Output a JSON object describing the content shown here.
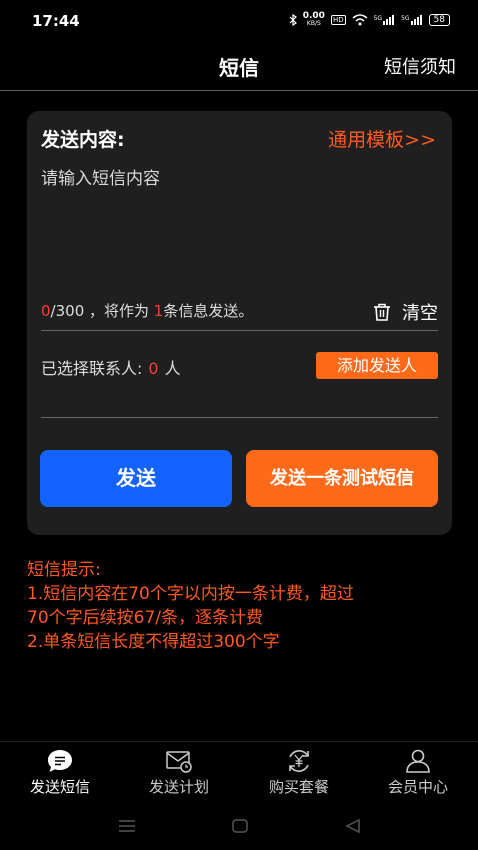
{
  "status_bar": {
    "time": "17:44",
    "speed": "0.00",
    "speed_unit": "KB/S",
    "hd": "HD",
    "signal1": "5G",
    "signal2": "5G",
    "battery": "58"
  },
  "header": {
    "title": "短信",
    "notice_link": "短信须知"
  },
  "compose": {
    "label": "发送内容:",
    "template_link": "通用模板>>",
    "placeholder": "请输入短信内容",
    "char_count": "0",
    "char_limit_text": "/300 ，将作为",
    "message_count": "1",
    "message_count_suffix": "条信息发送。",
    "clear_label": "清空"
  },
  "contacts": {
    "label": "已选择联系人:",
    "count": "0",
    "unit": "人",
    "add_button": "添加发送人"
  },
  "actions": {
    "send_button": "发送",
    "test_button": "发送一条测试短信"
  },
  "tips": {
    "title": "短信提示:",
    "line1": "1.短信内容在70个字以内按一条计费，超过",
    "line2": "70个字后续按67/条，逐条计费",
    "line3": "2.单条短信长度不得超过300个字"
  },
  "tabs": [
    {
      "label": "发送短信",
      "icon": "message-icon",
      "active": true
    },
    {
      "label": "发送计划",
      "icon": "envelope-clock-icon",
      "active": false
    },
    {
      "label": "购买套餐",
      "icon": "yen-refresh-icon",
      "active": false
    },
    {
      "label": "会员中心",
      "icon": "person-icon",
      "active": false
    }
  ],
  "colors": {
    "accent_orange": "#ff6a1a",
    "send_blue": "#1463ff",
    "count_red": "#ff3b2f"
  }
}
